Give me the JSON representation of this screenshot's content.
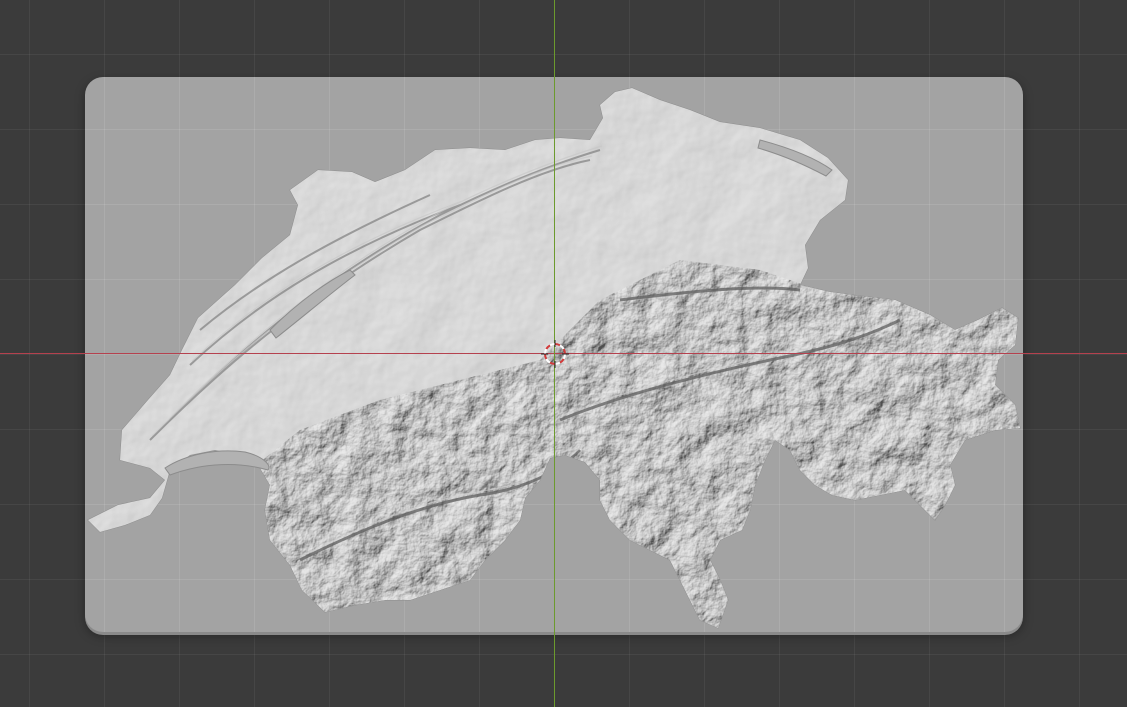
{
  "viewport": {
    "background": "#3b3b3b",
    "grid_color": "#4a4a4a",
    "plate_color": "#a3a3a3",
    "terrain_light": "#d9d9d9",
    "terrain_dark": "#4f4f4f",
    "axis_x_color": "#b5414e",
    "axis_y_color": "#6c9a2d"
  },
  "icons": {
    "cursor": "3d-cursor-icon"
  }
}
